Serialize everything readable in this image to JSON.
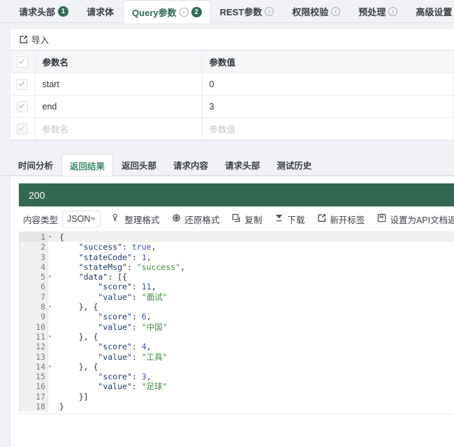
{
  "top_tabs": [
    {
      "label": "请求头部",
      "badge": "1",
      "info": false,
      "active": false,
      "name": "tab-request-headers"
    },
    {
      "label": "请求体",
      "badge": "",
      "info": false,
      "active": false,
      "name": "tab-request-body"
    },
    {
      "label": "Query参数",
      "badge": "2",
      "info": true,
      "active": true,
      "name": "tab-query-params"
    },
    {
      "label": "REST参数",
      "badge": "",
      "info": true,
      "active": false,
      "name": "tab-rest-params"
    },
    {
      "label": "权限校验",
      "badge": "",
      "info": true,
      "active": false,
      "name": "tab-auth-check"
    },
    {
      "label": "预处理",
      "badge": "",
      "info": true,
      "active": false,
      "name": "tab-preprocess"
    },
    {
      "label": "高级设置",
      "badge": "",
      "info": true,
      "active": false,
      "name": "tab-advanced-settings"
    }
  ],
  "params": {
    "import_label": "导入",
    "import_icon": "import-icon",
    "columns": [
      "参数名",
      "参数值"
    ],
    "rows": [
      {
        "name": "start",
        "value": "0",
        "placeholder": false
      },
      {
        "name": "end",
        "value": "3",
        "placeholder": false
      },
      {
        "name": "参数名",
        "value": "参数值",
        "placeholder": true
      }
    ]
  },
  "response_tabs": [
    {
      "label": "时间分析",
      "active": false,
      "name": "tab-time-analysis"
    },
    {
      "label": "返回结果",
      "active": true,
      "name": "tab-response-result"
    },
    {
      "label": "返回头部",
      "active": false,
      "name": "tab-response-headers"
    },
    {
      "label": "请求内容",
      "active": false,
      "name": "tab-request-content"
    },
    {
      "label": "请求头部",
      "active": false,
      "name": "tab-sent-headers"
    },
    {
      "label": "测试历史",
      "active": false,
      "name": "tab-test-history"
    }
  ],
  "response": {
    "status_code": "200",
    "status_color": "#30694f",
    "content_type_label": "内容类型",
    "content_type_value": "JSON",
    "actions": [
      {
        "label": "整理格式",
        "icon": "format-icon",
        "name": "format-button"
      },
      {
        "label": "还原格式",
        "icon": "restore-icon",
        "name": "restore-button"
      },
      {
        "label": "复制",
        "icon": "copy-icon",
        "name": "copy-button"
      },
      {
        "label": "下载",
        "icon": "download-icon",
        "name": "download-button"
      },
      {
        "label": "新开标签",
        "icon": "new-tab-icon",
        "name": "new-tab-button"
      },
      {
        "label": "设置为API文档返",
        "icon": "set-doc-icon",
        "name": "set-as-api-doc-button"
      }
    ]
  },
  "code": {
    "language": "JSON",
    "lines": [
      {
        "no": "1",
        "fold": true,
        "highlight": true,
        "tokens": [
          {
            "t": "{",
            "c": "p"
          }
        ]
      },
      {
        "no": "2",
        "fold": false,
        "highlight": false,
        "tokens": [
          {
            "t": "    \"success\"",
            "c": "k"
          },
          {
            "t": ": ",
            "c": "p"
          },
          {
            "t": "true",
            "c": "b"
          },
          {
            "t": ",",
            "c": "p"
          }
        ]
      },
      {
        "no": "3",
        "fold": false,
        "highlight": false,
        "tokens": [
          {
            "t": "    \"stateCode\"",
            "c": "k"
          },
          {
            "t": ": ",
            "c": "p"
          },
          {
            "t": "1",
            "c": "n"
          },
          {
            "t": ",",
            "c": "p"
          }
        ]
      },
      {
        "no": "4",
        "fold": false,
        "highlight": false,
        "tokens": [
          {
            "t": "    \"stateMsg\"",
            "c": "k"
          },
          {
            "t": ": ",
            "c": "p"
          },
          {
            "t": "\"success\"",
            "c": "s"
          },
          {
            "t": ",",
            "c": "p"
          }
        ]
      },
      {
        "no": "5",
        "fold": true,
        "highlight": false,
        "tokens": [
          {
            "t": "    \"data\"",
            "c": "k"
          },
          {
            "t": ": [{",
            "c": "p"
          }
        ]
      },
      {
        "no": "6",
        "fold": false,
        "highlight": false,
        "tokens": [
          {
            "t": "        \"score\"",
            "c": "k"
          },
          {
            "t": ": ",
            "c": "p"
          },
          {
            "t": "11",
            "c": "n"
          },
          {
            "t": ",",
            "c": "p"
          }
        ]
      },
      {
        "no": "7",
        "fold": false,
        "highlight": false,
        "tokens": [
          {
            "t": "        \"value\"",
            "c": "k"
          },
          {
            "t": ": ",
            "c": "p"
          },
          {
            "t": "\"面试\"",
            "c": "s"
          }
        ]
      },
      {
        "no": "8",
        "fold": true,
        "highlight": false,
        "tokens": [
          {
            "t": "    }, {",
            "c": "p"
          }
        ]
      },
      {
        "no": "9",
        "fold": false,
        "highlight": false,
        "tokens": [
          {
            "t": "        \"score\"",
            "c": "k"
          },
          {
            "t": ": ",
            "c": "p"
          },
          {
            "t": "6",
            "c": "n"
          },
          {
            "t": ",",
            "c": "p"
          }
        ]
      },
      {
        "no": "10",
        "fold": false,
        "highlight": false,
        "tokens": [
          {
            "t": "        \"value\"",
            "c": "k"
          },
          {
            "t": ": ",
            "c": "p"
          },
          {
            "t": "\"中国\"",
            "c": "s"
          }
        ]
      },
      {
        "no": "11",
        "fold": true,
        "highlight": false,
        "tokens": [
          {
            "t": "    }, {",
            "c": "p"
          }
        ]
      },
      {
        "no": "12",
        "fold": false,
        "highlight": false,
        "tokens": [
          {
            "t": "        \"score\"",
            "c": "k"
          },
          {
            "t": ": ",
            "c": "p"
          },
          {
            "t": "4",
            "c": "n"
          },
          {
            "t": ",",
            "c": "p"
          }
        ]
      },
      {
        "no": "13",
        "fold": false,
        "highlight": false,
        "tokens": [
          {
            "t": "        \"value\"",
            "c": "k"
          },
          {
            "t": ": ",
            "c": "p"
          },
          {
            "t": "\"工具\"",
            "c": "s"
          }
        ]
      },
      {
        "no": "14",
        "fold": true,
        "highlight": false,
        "tokens": [
          {
            "t": "    }, {",
            "c": "p"
          }
        ]
      },
      {
        "no": "15",
        "fold": false,
        "highlight": false,
        "tokens": [
          {
            "t": "        \"score\"",
            "c": "k"
          },
          {
            "t": ": ",
            "c": "p"
          },
          {
            "t": "3",
            "c": "n"
          },
          {
            "t": ",",
            "c": "p"
          }
        ]
      },
      {
        "no": "16",
        "fold": false,
        "highlight": false,
        "tokens": [
          {
            "t": "        \"value\"",
            "c": "k"
          },
          {
            "t": ": ",
            "c": "p"
          },
          {
            "t": "\"足球\"",
            "c": "s"
          }
        ]
      },
      {
        "no": "17",
        "fold": false,
        "highlight": false,
        "tokens": [
          {
            "t": "    }]",
            "c": "p"
          }
        ]
      },
      {
        "no": "18",
        "fold": false,
        "highlight": false,
        "tokens": [
          {
            "t": "}",
            "c": "p"
          }
        ]
      }
    ]
  }
}
